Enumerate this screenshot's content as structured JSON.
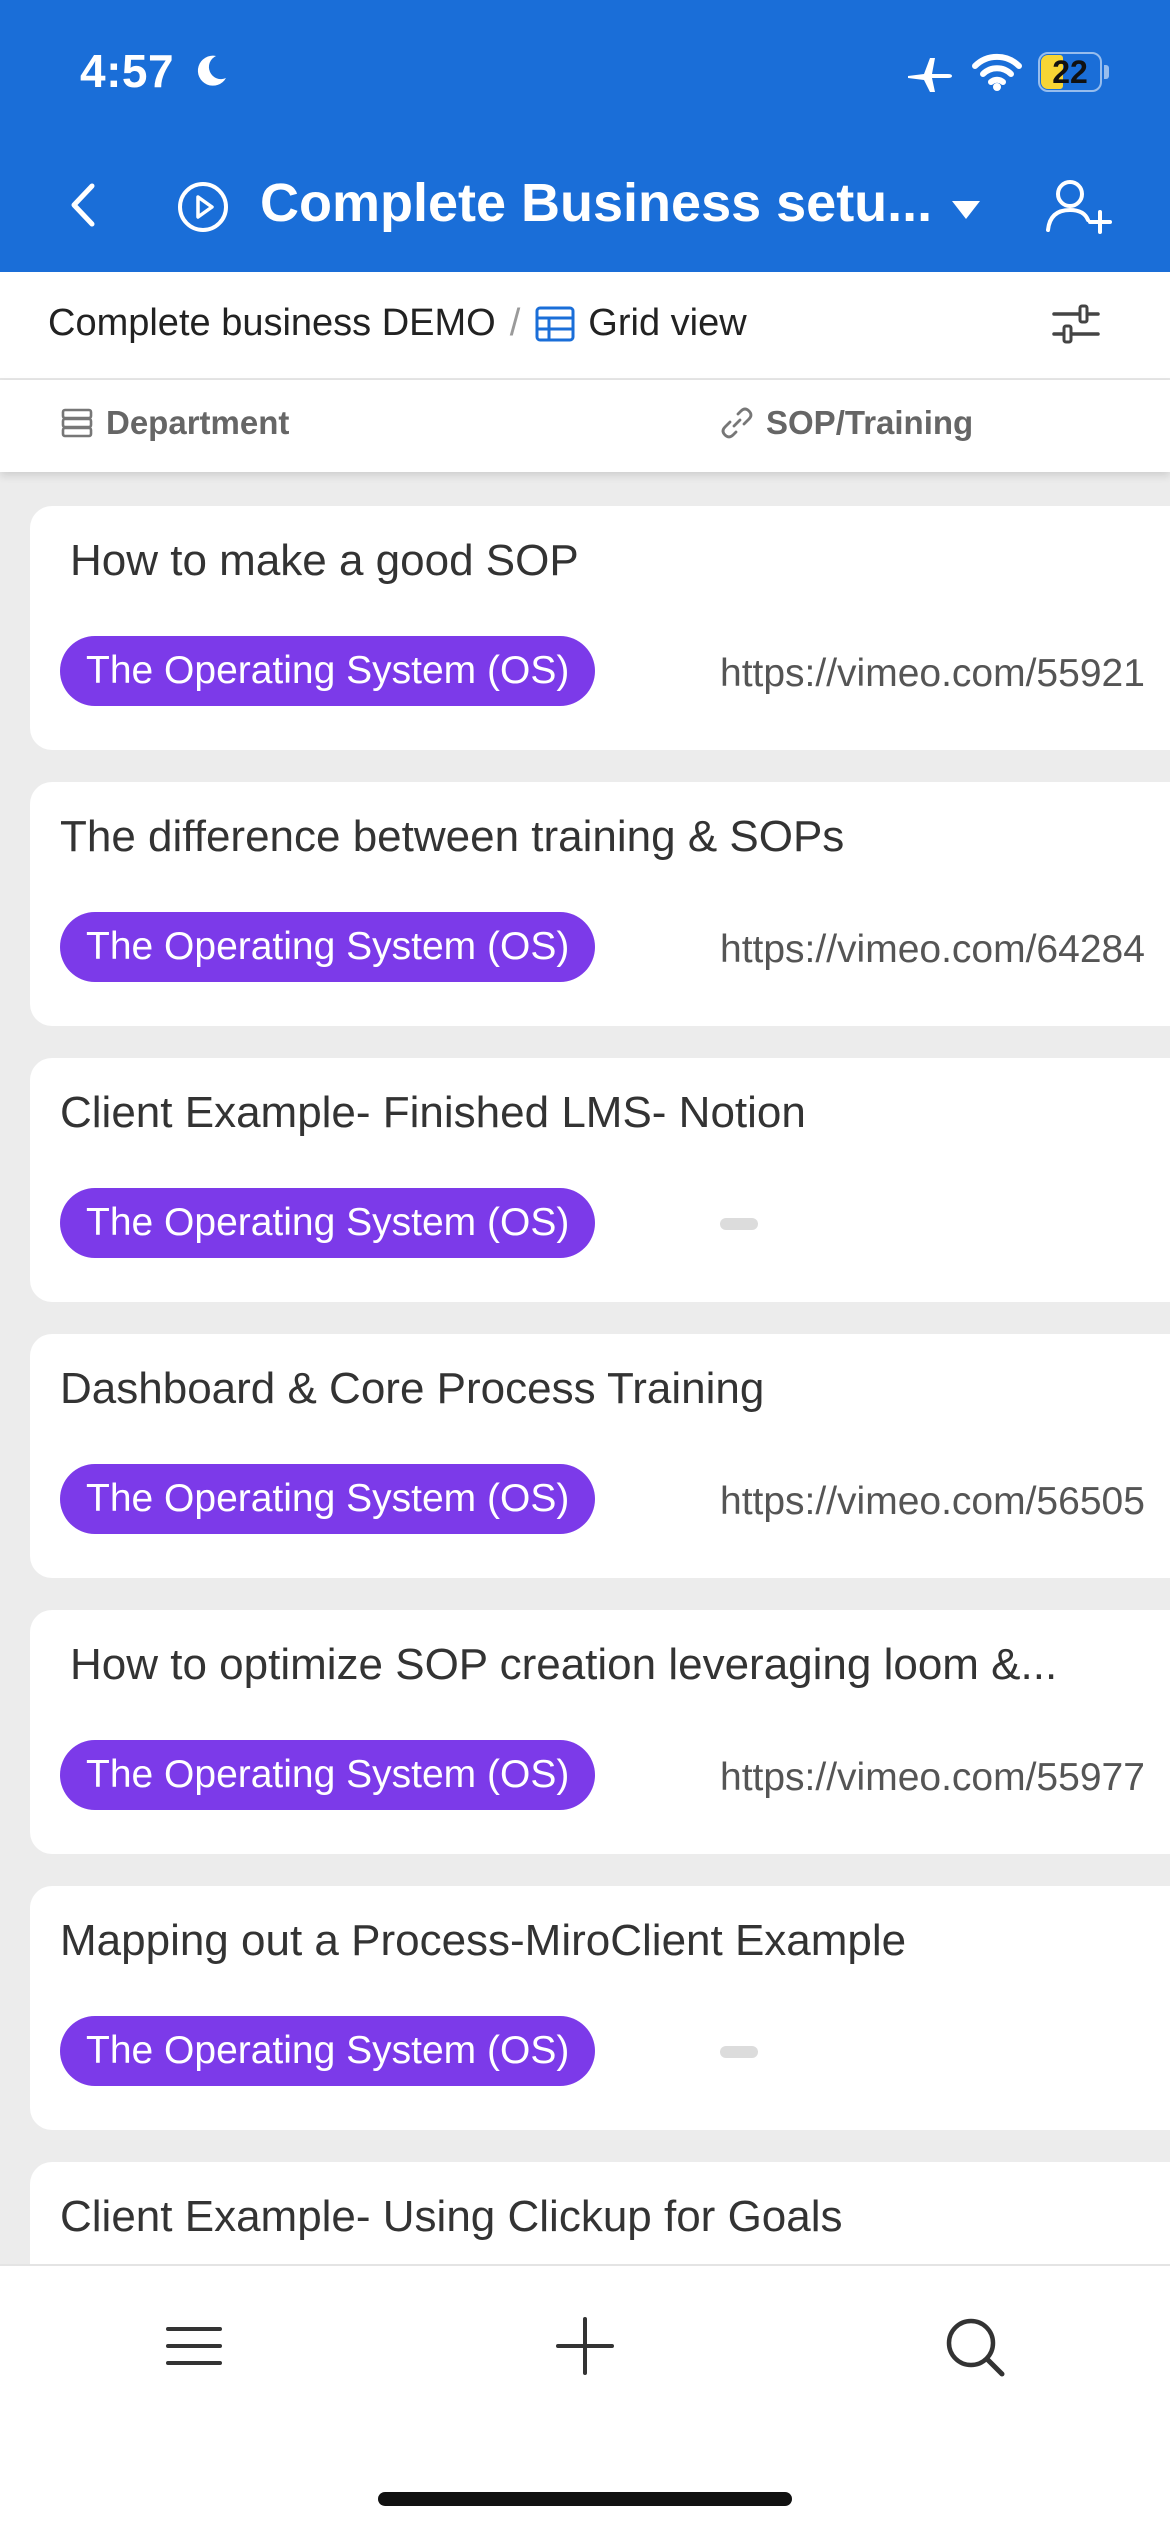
{
  "status_bar": {
    "time": "4:57",
    "battery": "22"
  },
  "nav": {
    "title": "Complete Business setu..."
  },
  "toolbar": {
    "base_name": "Complete business DEMO",
    "separator": "/",
    "view_name": "Grid view"
  },
  "columns": {
    "department": "Department",
    "sop_training": "SOP/Training"
  },
  "records": [
    {
      "title": "How to make a good SOP",
      "department": "The Operating System (OS)",
      "link": "https://vimeo.com/55921"
    },
    {
      "title": "The difference between training & SOPs",
      "department": "The Operating System (OS)",
      "link": "https://vimeo.com/64284"
    },
    {
      "title": "Client Example- Finished LMS- Notion",
      "department": "The Operating System (OS)",
      "link": ""
    },
    {
      "title": "Dashboard & Core Process Training",
      "department": "The Operating System (OS)",
      "link": "https://vimeo.com/56505"
    },
    {
      "title": "How to optimize SOP creation leveraging loom &...",
      "department": "The Operating System (OS)",
      "link": "https://vimeo.com/55977"
    },
    {
      "title": "Mapping out a Process-MiroClient Example",
      "department": "The Operating System (OS)",
      "link": ""
    },
    {
      "title": "Client Example- Using Clickup for Goals",
      "department": "",
      "link": ""
    }
  ],
  "icons": {
    "moon": "moon-icon",
    "airplane": "airplane-icon",
    "wifi": "wifi-icon",
    "back": "chevron-left-icon",
    "play": "play-circle-icon",
    "dropdown": "caret-down-icon",
    "add_user": "add-user-icon",
    "grid": "grid-view-icon",
    "filter": "sliders-icon",
    "department": "stack-icon",
    "link": "link-icon",
    "menu": "menu-icon",
    "add": "plus-icon",
    "search": "search-icon"
  },
  "colors": {
    "header_bg": "#1a6ed8",
    "tag_bg": "#7c3ae9",
    "battery_fill": "#f7d534",
    "page_bg": "#ececec"
  }
}
